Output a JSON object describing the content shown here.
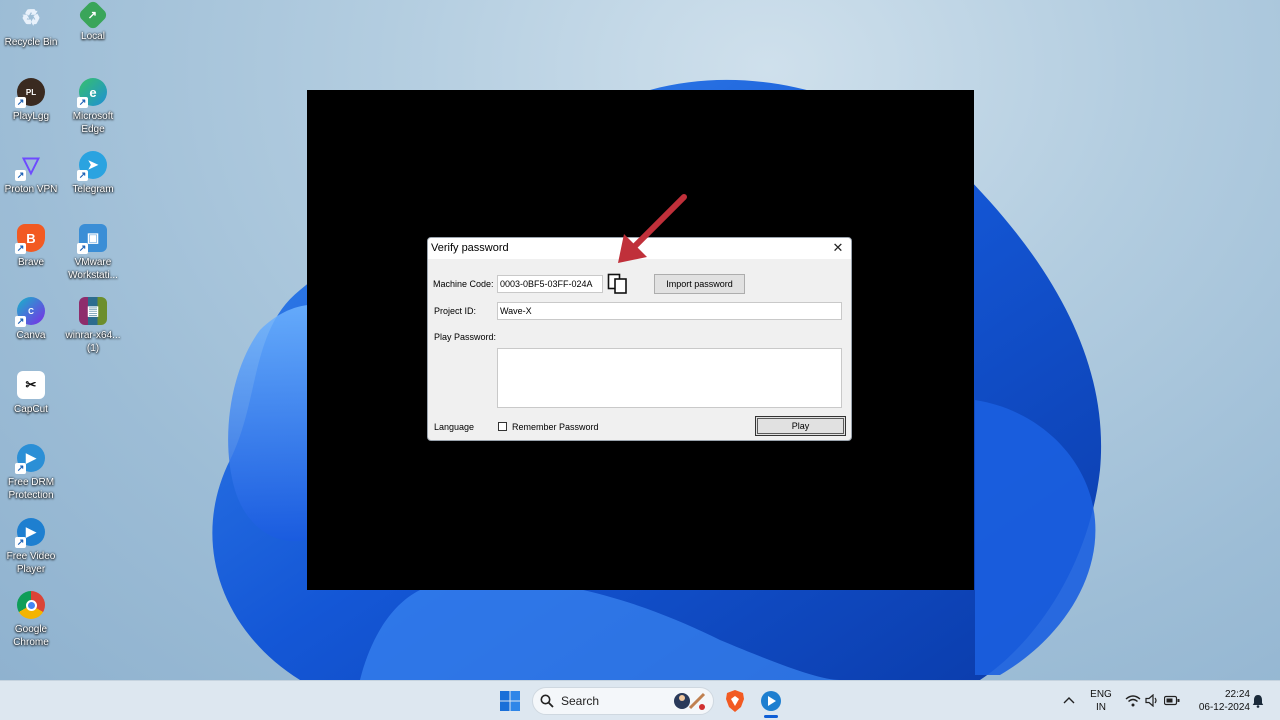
{
  "desktop": {
    "icons": [
      {
        "label": "Recycle Bin",
        "icon": "recycle-bin-icon",
        "color": "#6b8fb8"
      },
      {
        "label": "Local",
        "icon": "local-icon",
        "color": "#3aa55a"
      },
      {
        "label": "PlayLgg",
        "icon": "playlgg-icon",
        "color": "#3a2a20"
      },
      {
        "label": "Microsoft\nEdge",
        "icon": "edge-icon",
        "color": "#1f8fd6"
      },
      {
        "label": "Proton VPN",
        "icon": "proton-vpn-icon",
        "color": "#6d4aff"
      },
      {
        "label": "Telegram",
        "icon": "telegram-icon",
        "color": "#2aa3e0"
      },
      {
        "label": "Brave",
        "icon": "brave-icon",
        "color": "#f25a22"
      },
      {
        "label": "VMware\nWorkstati...",
        "icon": "vmware-icon",
        "color": "#3b8ed6"
      },
      {
        "label": "Canva",
        "icon": "canva-icon",
        "color": "#17b5c9"
      },
      {
        "label": "winrar-x64...\n(1)",
        "icon": "winrar-icon",
        "color": "#8e2d6c"
      },
      {
        "label": "CapCut",
        "icon": "capcut-icon",
        "color": "#111111"
      },
      {
        "label": "Free DRM\nProtection",
        "icon": "drm-protection-icon",
        "color": "#2b8fd6"
      },
      {
        "label": "Free Video\nPlayer",
        "icon": "video-player-icon",
        "color": "#1e7fd0"
      },
      {
        "label": "Google\nChrome",
        "icon": "chrome-icon",
        "color": "#db4437"
      }
    ]
  },
  "dialog": {
    "title": "Verify password",
    "machine_code_label": "Machine Code:",
    "machine_code_value": "0003-0BF5-03FF-024A",
    "import_button": "Import password",
    "project_id_label": "Project ID:",
    "project_id_value": "Wave-X",
    "play_password_label": "Play Password:",
    "play_password_value": "",
    "language_label": "Language",
    "remember_label": "Remember Password",
    "remember_checked": false,
    "play_button": "Play"
  },
  "annotation": {
    "arrow_color": "#c0303a"
  },
  "taskbar": {
    "search_label": "Search",
    "lang_top": "ENG",
    "lang_bottom": "IN",
    "time": "22:24",
    "date": "06-12-2024"
  },
  "colors": {
    "accent": "#0f5fd6",
    "dialog_bg": "#f0f0f0"
  }
}
